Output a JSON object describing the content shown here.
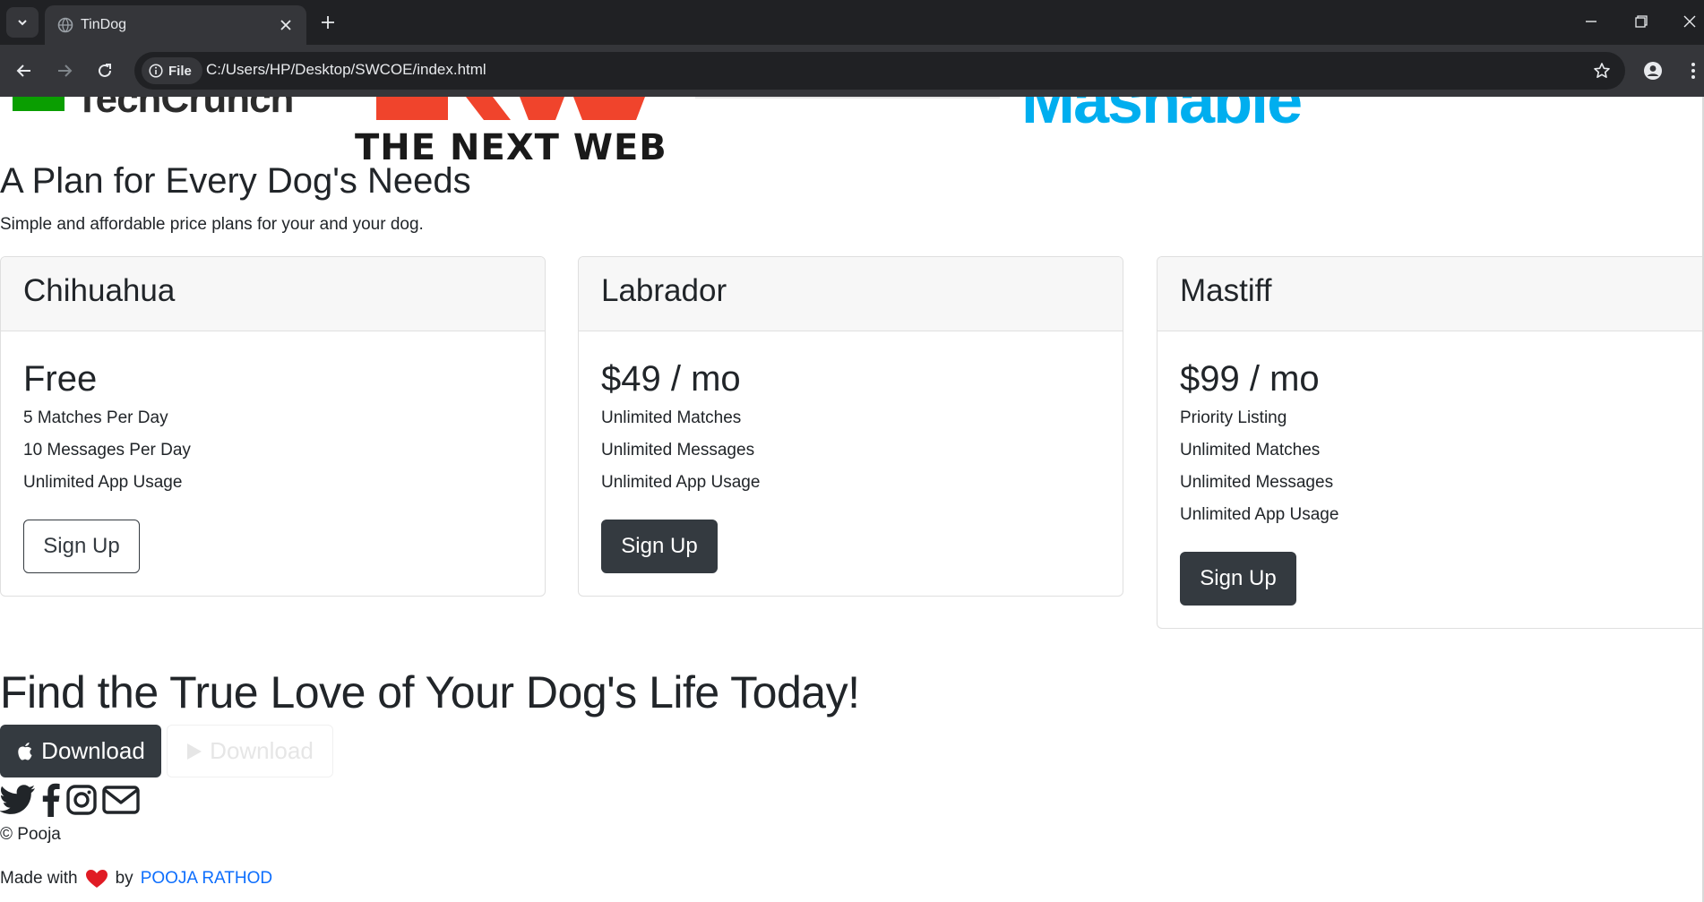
{
  "browser": {
    "tab_title": "TinDog",
    "url_chip": "File",
    "url": "C:/Users/HP/Desktop/SWCOE/index.html"
  },
  "press": {
    "tnw_label": "THE NEXT WEB",
    "mashable_label": "Mashable",
    "techcrunch_label": "TechCrunch"
  },
  "pricing": {
    "heading": "A Plan for Every Dog's Needs",
    "subheading": "Simple and affordable price plans for your and your dog.",
    "plans": [
      {
        "name": "Chihuahua",
        "price": "Free",
        "features": [
          "5 Matches Per Day",
          "10 Messages Per Day",
          "Unlimited App Usage"
        ],
        "button": "Sign Up"
      },
      {
        "name": "Labrador",
        "price": "$49 / mo",
        "features": [
          "Unlimited Matches",
          "Unlimited Messages",
          "Unlimited App Usage"
        ],
        "button": "Sign Up"
      },
      {
        "name": "Mastiff",
        "price": "$99 / mo",
        "features": [
          "Priority Listing",
          "Unlimited Matches",
          "Unlimited Messages",
          "Unlimited App Usage"
        ],
        "button": "Sign Up"
      }
    ]
  },
  "cta": {
    "heading": "Find the True Love of Your Dog's Life Today!",
    "apple_button": "Download",
    "google_button": "Download"
  },
  "footer": {
    "copyright": "© Pooja",
    "made_with_prefix": "Made with",
    "made_with_by": "by",
    "author_link": "POOJA RATHOD",
    "social_icons": [
      "twitter-icon",
      "facebook-icon",
      "instagram-icon",
      "envelope-icon"
    ]
  },
  "colors": {
    "dark_button": "#343a40",
    "link": "#0d6efd",
    "heart": "#e01b24",
    "mashable": "#00aeef",
    "tnw": "#f0442c",
    "techcrunch": "#0a9e01"
  }
}
